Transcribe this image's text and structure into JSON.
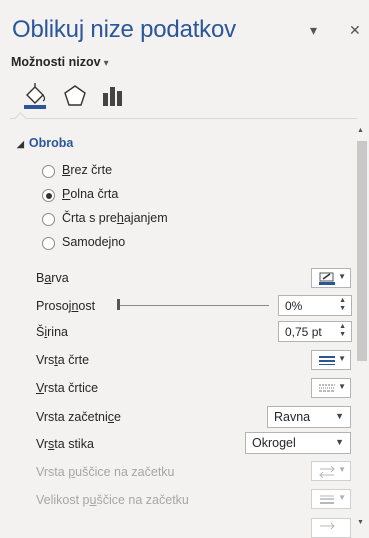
{
  "pane": {
    "title": "Oblikuj nize podatkov",
    "dropdown_glyph": "▾",
    "close_glyph": "✕"
  },
  "options": {
    "label": "Možnosti nizov",
    "caret": "▾"
  },
  "category_icons": [
    "fill-line-icon",
    "effects-icon",
    "series-options-icon"
  ],
  "section": {
    "title": "Obroba",
    "expanded_glyph": "◢"
  },
  "line_options": [
    {
      "pre": "",
      "key": "B",
      "post": "rez črte",
      "selected": false
    },
    {
      "pre": "",
      "key": "P",
      "post": "olna črta",
      "selected": true
    },
    {
      "pre": "Črta s pre",
      "key": "h",
      "post": "ajanjem",
      "selected": false
    },
    {
      "pre": "Samodejno",
      "key": "",
      "post": "",
      "selected": false
    }
  ],
  "rows": {
    "color": {
      "pre": "B",
      "key": "a",
      "post": "rva"
    },
    "transparency": {
      "pre": "Prosoj",
      "key": "n",
      "post": "ost",
      "value": "0%",
      "level": 0
    },
    "width": {
      "pre": "Š",
      "key": "i",
      "post": "rina",
      "value": "0,75 pt"
    },
    "compound": {
      "pre": "Vrs",
      "key": "t",
      "post": "a črte"
    },
    "dash": {
      "pre": "",
      "key": "V",
      "post": "rsta črtice"
    },
    "cap": {
      "pre": "Vrsta začetni",
      "key": "c",
      "post": "e",
      "value": "Ravna"
    },
    "join": {
      "pre": "Vr",
      "key": "s",
      "post": "ta stika",
      "value": "Okrogel"
    },
    "begin_arrow_type": {
      "pre": "Vrsta ",
      "key": "p",
      "post": "uščice na začetku"
    },
    "begin_arrow_size": {
      "pre": "Velikost p",
      "key": "u",
      "post": "ščice na začetku"
    }
  },
  "colors": {
    "title": "#2b579a",
    "accent": "#2b579a",
    "background": "#f3f2f1"
  }
}
